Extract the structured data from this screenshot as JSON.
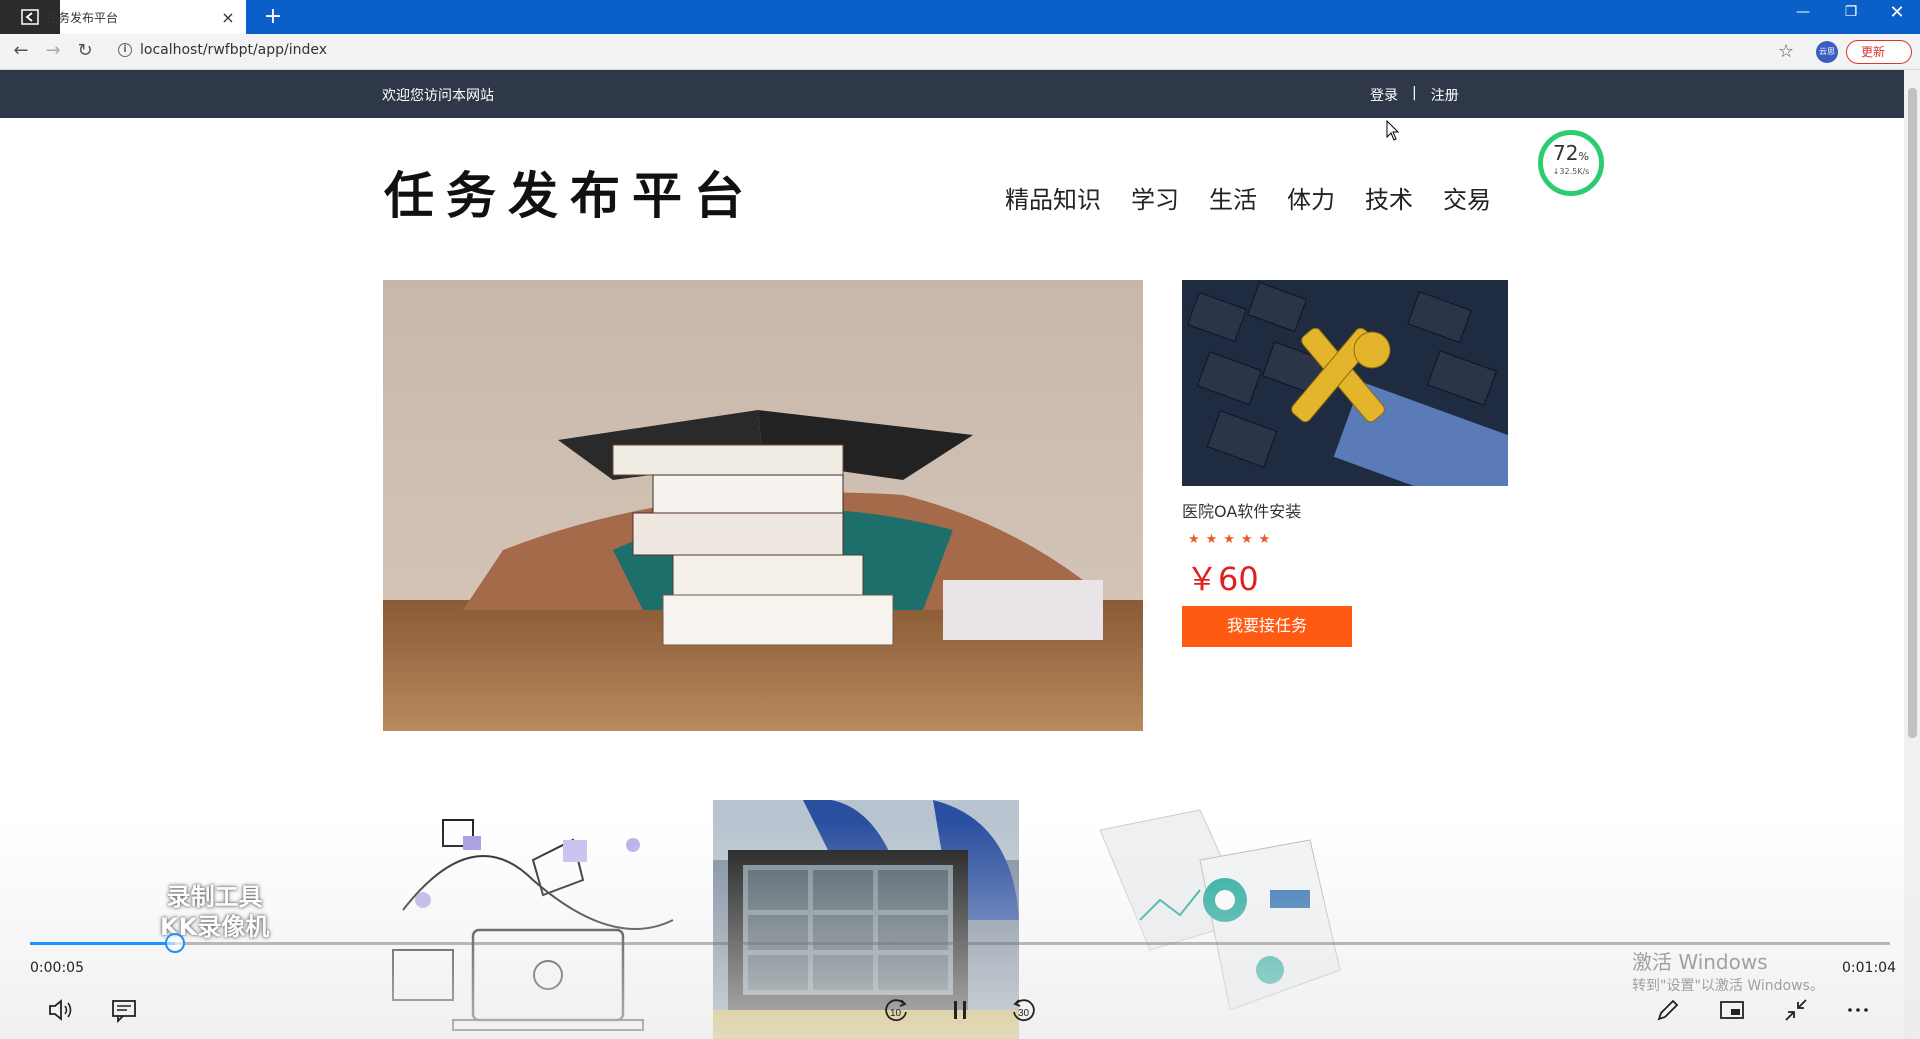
{
  "browser": {
    "tab_title": "任务发布平台",
    "tab_close": "×",
    "new_tab": "+",
    "url": "localhost/rwfbpt/app/index",
    "profile_label": "云思",
    "update_label": "更新"
  },
  "header": {
    "welcome": "欢迎您访问本网站",
    "login": "登录",
    "separator": "|",
    "register": "注册"
  },
  "site": {
    "logo": "任务发布平台",
    "nav": [
      "精品知识",
      "学习",
      "生活",
      "体力",
      "技术",
      "交易"
    ]
  },
  "speed_widget": {
    "percent": "72",
    "percent_sign": "%",
    "rate": "↓32.5K/s"
  },
  "featured_task": {
    "title": "医院OA软件安装",
    "rating_stars": "★★★★★",
    "rating": 5,
    "price": "￥60",
    "accept_label": "我要接任务"
  },
  "player": {
    "watermark_line1": "录制工具",
    "watermark_line2": "KK录像机",
    "time_current": "0:00:05",
    "time_total": "0:01:04",
    "progress": 0.078,
    "rewind_label": "10",
    "forward_label": "30",
    "activate_line1": "激活 Windows",
    "activate_line2": "转到\"设置\"以激活 Windows。"
  },
  "colors": {
    "tabbar": "#0a60c8",
    "topstrip": "#2f3848",
    "accept_button": "#ff5a14",
    "price": "#e02020",
    "progress": "#1e90ff"
  }
}
